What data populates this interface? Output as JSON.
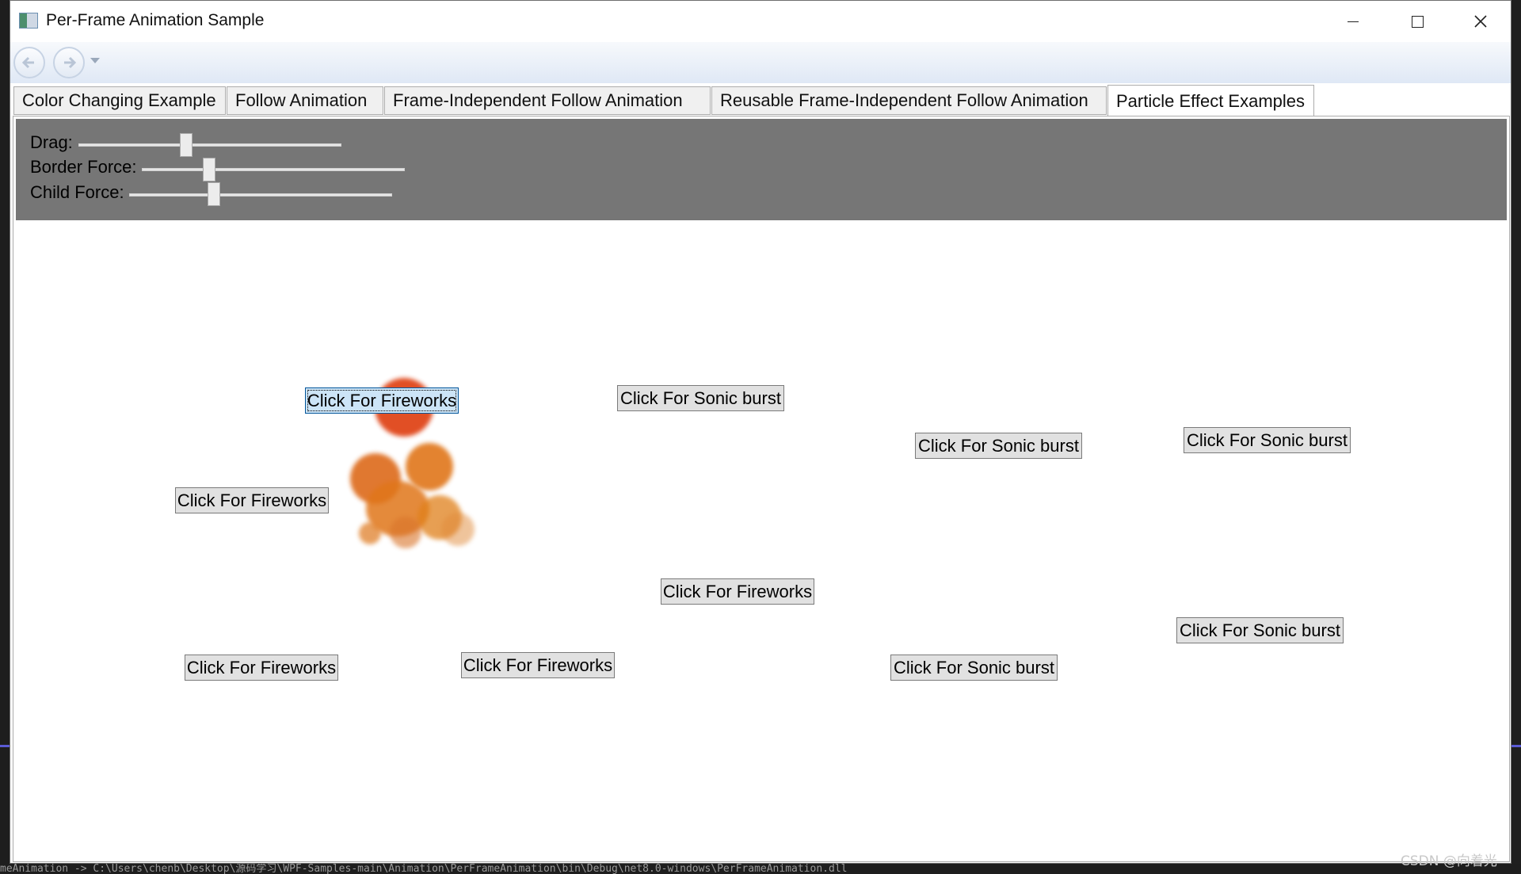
{
  "window": {
    "title": "Per-Frame Animation Sample"
  },
  "tabs": [
    {
      "label": "Color Changing Example",
      "active": false
    },
    {
      "label": "Follow Animation",
      "active": false
    },
    {
      "label": "Frame-Independent Follow Animation",
      "active": false
    },
    {
      "label": "Reusable Frame-Independent Follow Animation",
      "active": false
    },
    {
      "label": "Particle Effect Examples",
      "active": true
    }
  ],
  "controls": {
    "drag": {
      "label": "Drag:",
      "value_fraction": 0.41
    },
    "border_force": {
      "label": "Border Force:",
      "value_fraction": 0.25
    },
    "child_force": {
      "label": "Child Force:",
      "value_fraction": 0.32
    }
  },
  "buttons": {
    "fireworks_1": "Click For Fireworks",
    "fireworks_2": "Click For Fireworks",
    "fireworks_3": "Click For Fireworks",
    "fireworks_4": "Click For Fireworks",
    "fireworks_5": "Click For Fireworks",
    "sonic_1": "Click For Sonic burst",
    "sonic_2": "Click For Sonic burst",
    "sonic_3": "Click For Sonic burst",
    "sonic_4": "Click For Sonic burst",
    "sonic_5": "Click For Sonic burst"
  },
  "background": {
    "terminal_line": "meAnimation -> C:\\Users\\chenb\\Desktop\\源码学习\\WPF-Samples-main\\Animation\\PerFrameAnimation\\bin\\Debug\\net8.0-windows\\PerFrameAnimation.dll",
    "watermark": "CSDN @向着光"
  },
  "colors": {
    "panel": "#767676",
    "particle_red": "#e0461a",
    "particle_orange": "#e0761a",
    "focus_blue": "#cce4f7"
  }
}
